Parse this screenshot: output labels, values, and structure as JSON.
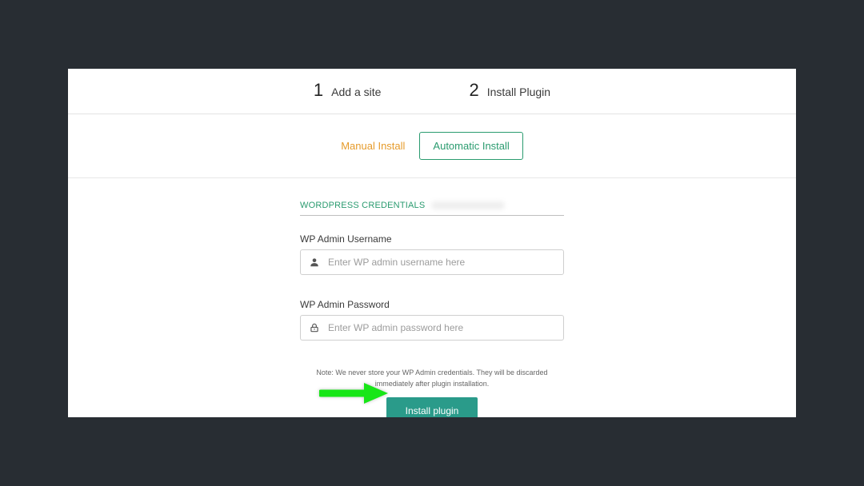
{
  "steps": [
    {
      "num": "1",
      "label": "Add a site"
    },
    {
      "num": "2",
      "label": "Install Plugin"
    }
  ],
  "tabs": {
    "manual": "Manual Install",
    "automatic": "Automatic Install"
  },
  "credentials_header": "WORDPRESS CREDENTIALS",
  "fields": {
    "username": {
      "label": "WP Admin Username",
      "placeholder": "Enter WP admin username here"
    },
    "password": {
      "label": "WP Admin Password",
      "placeholder": "Enter WP admin password here"
    }
  },
  "note": "Note: We never store your WP Admin credentials. They will be discarded immediately after plugin installation.",
  "install_button": "Install plugin"
}
